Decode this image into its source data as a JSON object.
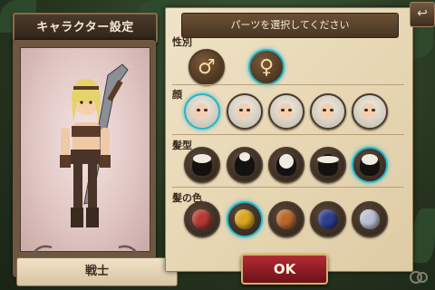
{
  "screen": {
    "title": "キャラクター設定",
    "instruction": "パーツを選択してください"
  },
  "character": {
    "class_name": "戦士",
    "rotate_left": "rotate-left-arrow",
    "rotate_right": "rotate-right-arrow"
  },
  "sections": {
    "gender": {
      "label": "性別",
      "options": [
        "♂",
        "♀"
      ],
      "selected_index": 1
    },
    "face": {
      "label": "顔",
      "count": 5,
      "selected_index": 0
    },
    "hairstyle": {
      "label": "髪型",
      "count": 5,
      "selected_index": 4
    },
    "hair_color": {
      "label": "髪の色",
      "colors": [
        "#b53a33",
        "#d9a524",
        "#b86a2c",
        "#2d3f8f",
        "#b9c0d1"
      ],
      "selected_index": 1
    }
  },
  "buttons": {
    "ok": "OK",
    "back_icon": "back-arrow-icon"
  },
  "colors": {
    "selection_ring": "#28b5c8",
    "ok_button": "#9c1f27"
  }
}
